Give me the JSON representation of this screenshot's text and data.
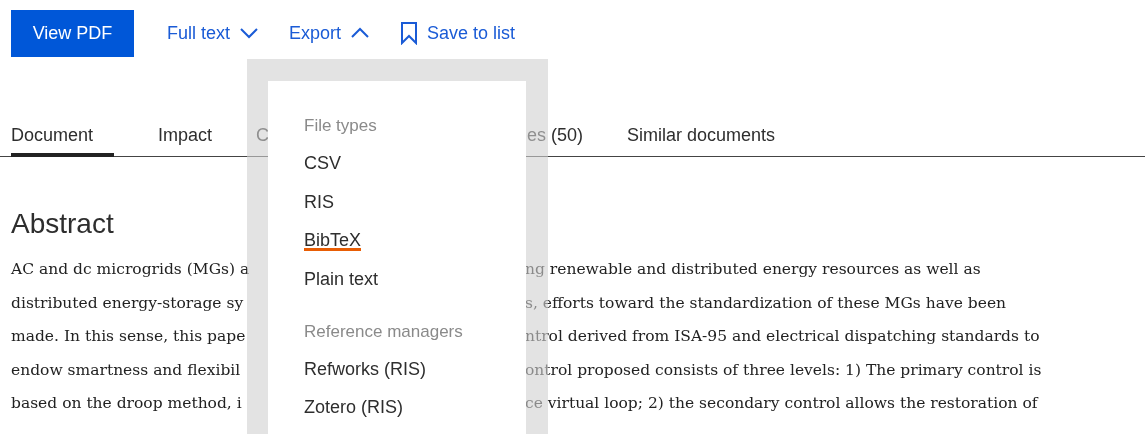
{
  "toolbar": {
    "view_pdf": "View PDF",
    "links": [
      {
        "kind": "dropdown",
        "label": "Full text",
        "expanded": false
      },
      {
        "kind": "dropdown",
        "label": "Export",
        "expanded": true
      },
      {
        "kind": "bookmark",
        "label": "Save to list"
      }
    ]
  },
  "tabs": [
    {
      "label": "Document",
      "selected": true
    },
    {
      "label": "Impact",
      "selected": false
    },
    {
      "label": "C",
      "selected": false
    },
    {
      "label": "es (50)",
      "selected": false
    },
    {
      "label": "Similar documents",
      "selected": false
    }
  ],
  "abstract": {
    "heading": "Abstract",
    "lines": [
      {
        "visible_start": "AC and dc microgrids (MGs) a",
        "visible_end": "ng renewable and distributed energy resources as well as"
      },
      {
        "visible_start": "distributed energy-storage sy",
        "visible_end": "s, efforts toward the standardization of these MGs have been"
      },
      {
        "visible_start": "made. In this sense, this pape",
        "visible_end": "ntrol derived from ISA-95 and electrical dispatching standards to"
      },
      {
        "visible_start": "endow smartness and flexibil",
        "visible_end": "ontrol proposed consists of three levels: 1) The primary control is"
      },
      {
        "visible_start": "based on the droop method, i",
        "visible_end": "ce virtual loop; 2) the secondary control allows the restoration of"
      }
    ]
  },
  "export_menu": {
    "sections": [
      {
        "heading": "File types",
        "items": [
          {
            "label": "CSV",
            "highlighted": false
          },
          {
            "label": "RIS",
            "highlighted": false
          },
          {
            "label": "BibTeX",
            "highlighted": true
          },
          {
            "label": "Plain text",
            "highlighted": false
          }
        ]
      },
      {
        "heading": "Reference managers",
        "items": [
          {
            "label": "Refworks (RIS)",
            "highlighted": false
          },
          {
            "label": "Zotero (RIS)",
            "highlighted": false
          }
        ]
      }
    ]
  }
}
